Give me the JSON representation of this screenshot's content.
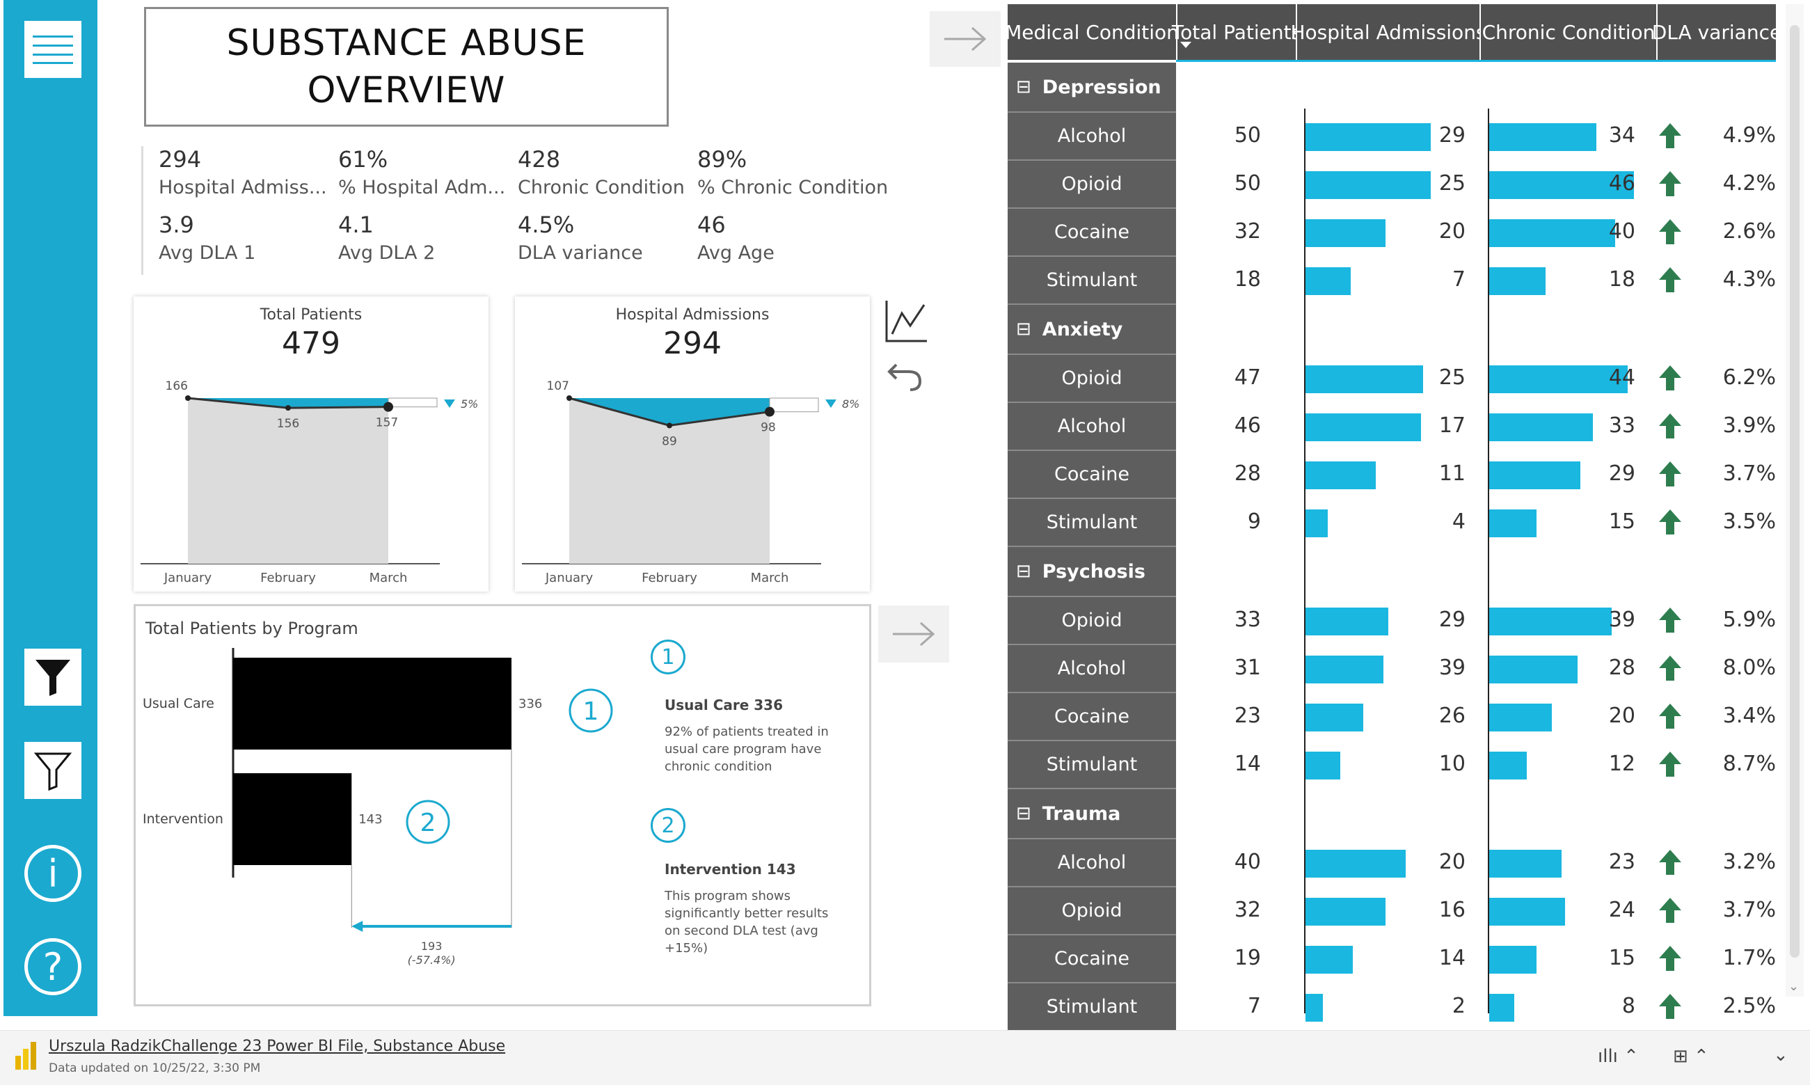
{
  "title_line1": "SUBSTANCE ABUSE",
  "title_line2": "OVERVIEW",
  "kpis": [
    {
      "value": "294",
      "label": "Hospital Admiss..."
    },
    {
      "value": "61%",
      "label": "% Hospital Adm..."
    },
    {
      "value": "428",
      "label": "Chronic Condition"
    },
    {
      "value": "89%",
      "label": "% Chronic Condition"
    },
    {
      "value": "3.9",
      "label": "Avg DLA 1"
    },
    {
      "value": "4.1",
      "label": "Avg DLA 2"
    },
    {
      "value": "4.5%",
      "label": "DLA variance"
    },
    {
      "value": "46",
      "label": "Avg Age"
    }
  ],
  "patients_card": {
    "title": "Total Patients",
    "total": "479",
    "months": [
      "January",
      "February",
      "March"
    ],
    "values": [
      166,
      156,
      157
    ],
    "variance": "5%"
  },
  "admissions_card": {
    "title": "Hospital Admissions",
    "total": "294",
    "months": [
      "January",
      "February",
      "March"
    ],
    "values": [
      107,
      89,
      98
    ],
    "variance": "8%"
  },
  "program_card": {
    "title": "Total Patients by Program",
    "categories": [
      "Usual Care",
      "Intervention"
    ],
    "values": [
      336,
      143
    ],
    "diff_value": "193",
    "diff_pct": "(-57.4%)",
    "badge1": "1",
    "badge2": "2",
    "note1_title": "Usual Care 336",
    "note1_body": [
      "92% of patients treated in",
      "usual care program have",
      "chronic condition"
    ],
    "note2_title": "Intervention 143",
    "note2_body": [
      "This program shows",
      "significantly better results",
      "on second DLA test (avg",
      "+15%)"
    ]
  },
  "table": {
    "headers": [
      "Medical Condition",
      "Total Patients",
      "Hospital Admissions",
      "Chronic Condition",
      "DLA variance"
    ],
    "groups": [
      {
        "name": "Depression",
        "rows": [
          {
            "name": "Alcohol",
            "patients": 50,
            "admissions": 29,
            "chronic": 34,
            "dla": "4.9%"
          },
          {
            "name": "Opioid",
            "patients": 50,
            "admissions": 25,
            "chronic": 46,
            "dla": "4.2%"
          },
          {
            "name": "Cocaine",
            "patients": 32,
            "admissions": 20,
            "chronic": 40,
            "dla": "2.6%"
          },
          {
            "name": "Stimulant",
            "patients": 18,
            "admissions": 7,
            "chronic": 18,
            "dla": "4.3%"
          }
        ]
      },
      {
        "name": "Anxiety",
        "rows": [
          {
            "name": "Opioid",
            "patients": 47,
            "admissions": 25,
            "chronic": 44,
            "dla": "6.2%"
          },
          {
            "name": "Alcohol",
            "patients": 46,
            "admissions": 17,
            "chronic": 33,
            "dla": "3.9%"
          },
          {
            "name": "Cocaine",
            "patients": 28,
            "admissions": 11,
            "chronic": 29,
            "dla": "3.7%"
          },
          {
            "name": "Stimulant",
            "patients": 9,
            "admissions": 4,
            "chronic": 15,
            "dla": "3.5%"
          }
        ]
      },
      {
        "name": "Psychosis",
        "rows": [
          {
            "name": "Opioid",
            "patients": 33,
            "admissions": 29,
            "chronic": 39,
            "dla": "5.9%"
          },
          {
            "name": "Alcohol",
            "patients": 31,
            "admissions": 39,
            "chronic": 28,
            "dla": "8.0%"
          },
          {
            "name": "Cocaine",
            "patients": 23,
            "admissions": 26,
            "chronic": 20,
            "dla": "3.4%"
          },
          {
            "name": "Stimulant",
            "patients": 14,
            "admissions": 10,
            "chronic": 12,
            "dla": "8.7%"
          }
        ]
      },
      {
        "name": "Trauma",
        "rows": [
          {
            "name": "Alcohol",
            "patients": 40,
            "admissions": 20,
            "chronic": 23,
            "dla": "3.2%"
          },
          {
            "name": "Opioid",
            "patients": 32,
            "admissions": 16,
            "chronic": 24,
            "dla": "3.7%"
          },
          {
            "name": "Cocaine",
            "patients": 19,
            "admissions": 14,
            "chronic": 15,
            "dla": "1.7%"
          },
          {
            "name": "Stimulant",
            "patients": 7,
            "admissions": 2,
            "chronic": 8,
            "dla": "2.5%"
          }
        ]
      }
    ]
  },
  "status": {
    "file_name": "Urszula RadzikChallenge 23 Power BI File, Substance Abuse",
    "updated": "Data updated on 10/25/22, 3:30 PM"
  },
  "colors": {
    "accent": "#1ba9cf",
    "bar": "#1ab7e0",
    "up_arrow": "#2e7d4f",
    "header": "#505050"
  },
  "chart_data": [
    {
      "type": "area",
      "title": "Total Patients",
      "categories": [
        "January",
        "February",
        "March"
      ],
      "values": [
        166,
        156,
        157
      ]
    },
    {
      "type": "area",
      "title": "Hospital Admissions",
      "categories": [
        "January",
        "February",
        "March"
      ],
      "values": [
        107,
        89,
        98
      ]
    },
    {
      "type": "bar",
      "title": "Total Patients by Program",
      "categories": [
        "Usual Care",
        "Intervention"
      ],
      "values": [
        336,
        143
      ]
    }
  ]
}
